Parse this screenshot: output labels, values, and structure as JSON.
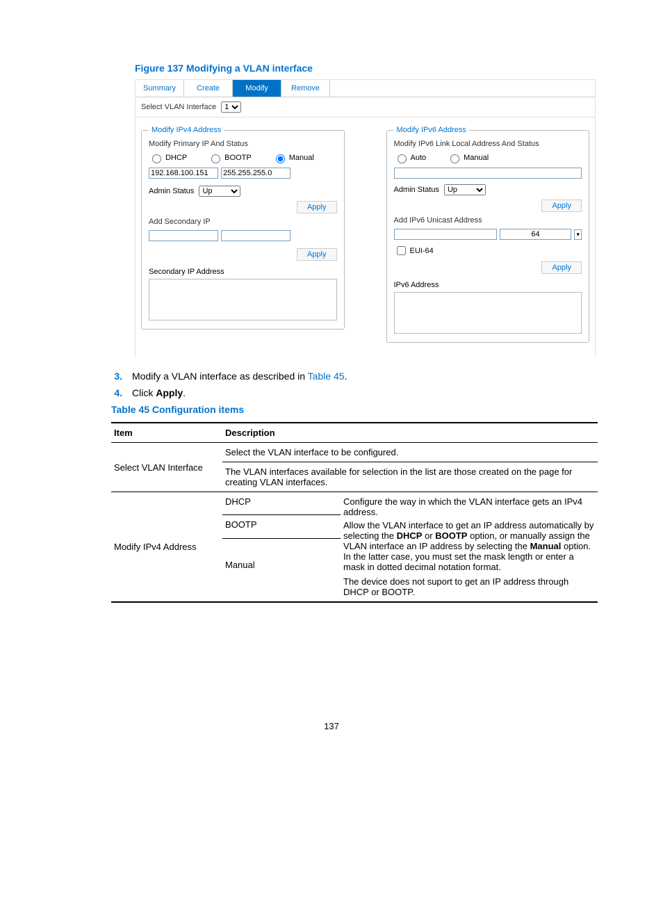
{
  "figure_title": "Figure 137 Modifying a VLAN interface",
  "tabs": {
    "summary": "Summary",
    "create": "Create",
    "modify": "Modify",
    "remove": "Remove"
  },
  "select_label": "Select VLAN Interface",
  "select_value": "1",
  "ipv4": {
    "legend": "Modify IPv4 Address",
    "sub": "Modify Primary IP And Status",
    "dhcp": "DHCP",
    "bootp": "BOOTP",
    "manual": "Manual",
    "ip": "192.168.100.151",
    "mask": "255.255.255.0",
    "admin_label": "Admin Status",
    "admin_value": "Up",
    "apply": "Apply",
    "add_secondary": "Add Secondary IP",
    "secondary_list": "Secondary IP Address"
  },
  "ipv6": {
    "legend": "Modify IPv6 Address",
    "sub": "Modify IPv6 Link Local Address And Status",
    "auto": "Auto",
    "manual": "Manual",
    "admin_label": "Admin Status",
    "admin_value": "Up",
    "apply": "Apply",
    "add_unicast": "Add IPv6 Unicast Address",
    "prefix": "64",
    "eui": "EUI-64",
    "addr_list": "IPv6 Address"
  },
  "steps": {
    "s3_num": "3.",
    "s3_text_a": "Modify a VLAN interface as described in ",
    "s3_link": "Table 45",
    "s3_text_b": ".",
    "s4_num": "4.",
    "s4_text_a": "Click ",
    "s4_bold": "Apply",
    "s4_text_b": "."
  },
  "table_title": "Table 45 Configuration items",
  "table": {
    "h1": "Item",
    "h2": "Description",
    "r1_item": "Select VLAN Interface",
    "r1_d1": "Select the VLAN interface to be configured.",
    "r1_d2": "The VLAN interfaces available for selection in the list are those created on the page for creating VLAN interfaces.",
    "r2_item": "Modify IPv4 Address",
    "r2_dhcp": "DHCP",
    "r2_bootp": "BOOTP",
    "r2_manual": "Manual",
    "r2_d_intro": "Configure the way in which the VLAN interface gets an IPv4 address.",
    "r2_d_p1a": "Allow the VLAN interface to get an IP address automatically by selecting the ",
    "r2_d_p1b": " or ",
    "r2_d_p1c": " option, or manually assign the VLAN interface an IP address by selecting the ",
    "r2_d_p1d": " option. In the latter case, you must set the mask length or enter a mask in dotted decimal notation format.",
    "r2_bold_dhcp": "DHCP",
    "r2_bold_bootp": "BOOTP",
    "r2_bold_manual": "Manual",
    "r2_d_p2": "The device does not suport to get an IP address through DHCP or BOOTP."
  },
  "page_number": "137"
}
